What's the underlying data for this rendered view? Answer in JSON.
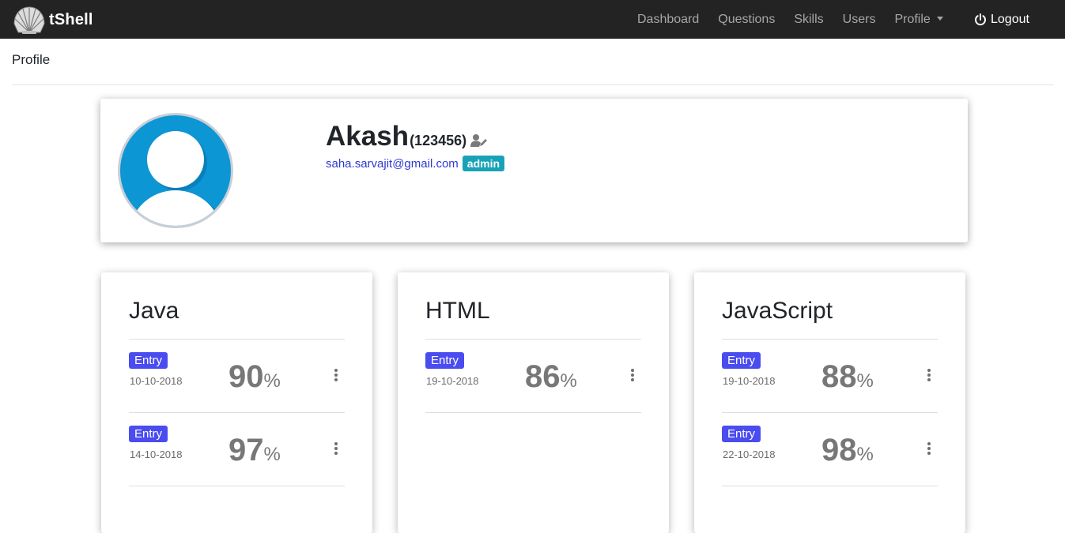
{
  "navbar": {
    "brand": "tShell",
    "links": [
      "Dashboard",
      "Questions",
      "Skills",
      "Users",
      "Profile"
    ],
    "logout_label": "Logout"
  },
  "page": {
    "title": "Profile"
  },
  "profile": {
    "name": "Akash",
    "id": "(123456)",
    "email": "saha.sarvajit@gmail.com",
    "role": "admin"
  },
  "skills": [
    {
      "name": "Java",
      "results": [
        {
          "level": "Entry",
          "date": "10-10-2018",
          "score": "90",
          "unit": "%"
        },
        {
          "level": "Entry",
          "date": "14-10-2018",
          "score": "97",
          "unit": "%"
        }
      ]
    },
    {
      "name": "HTML",
      "results": [
        {
          "level": "Entry",
          "date": "19-10-2018",
          "score": "86",
          "unit": "%"
        }
      ]
    },
    {
      "name": "JavaScript",
      "results": [
        {
          "level": "Entry",
          "date": "19-10-2018",
          "score": "88",
          "unit": "%"
        },
        {
          "level": "Entry",
          "date": "22-10-2018",
          "score": "98",
          "unit": "%"
        }
      ]
    }
  ],
  "colors": {
    "navbar_bg": "#232323",
    "badge_entry": "#4a4cf0",
    "badge_admin": "#17a2b8",
    "link_email": "#2c39d1"
  }
}
